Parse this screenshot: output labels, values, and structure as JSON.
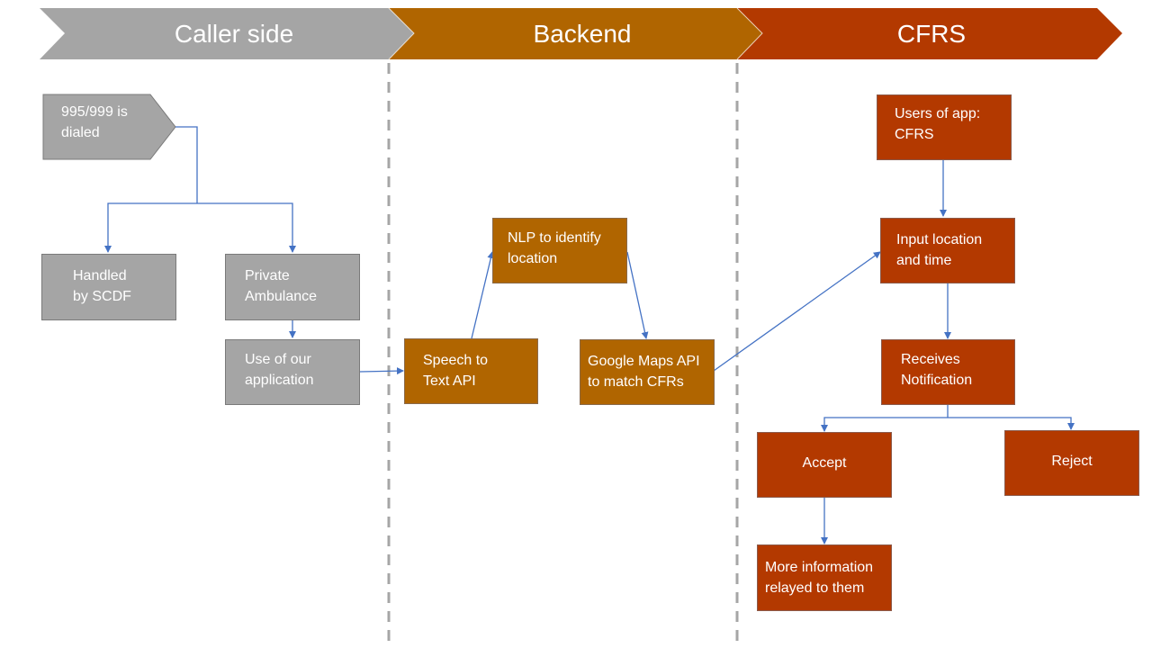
{
  "colors": {
    "caller": "#a5a5a5",
    "backend": "#b06500",
    "cfrs": "#b33900",
    "connector": "#4472c4",
    "divider": "#a6a6a6"
  },
  "bands": [
    {
      "label": "Caller side"
    },
    {
      "label": "Backend"
    },
    {
      "label": "CFRS"
    }
  ],
  "nodes": {
    "dialed": {
      "label": "995/999 is\ndialed"
    },
    "scdf": {
      "label": "Handled\nby SCDF"
    },
    "private_ambulance": {
      "label": "Private\nAmbulance"
    },
    "use_app": {
      "label": "Use of our\napplication"
    },
    "speech_to_text": {
      "label": "Speech to\nText API"
    },
    "nlp": {
      "label": "NLP to identify\nlocation"
    },
    "google_maps": {
      "label": "Google Maps API\nto match CFRs"
    },
    "users_app": {
      "label": "Users of app:\nCFRS"
    },
    "input_location": {
      "label": "Input location\nand time"
    },
    "receives_notification": {
      "label": "Receives\nNotification"
    },
    "accept": {
      "label": "Accept"
    },
    "reject": {
      "label": "Reject"
    },
    "more_info": {
      "label": "More information\nrelayed to them"
    }
  },
  "edges": [
    {
      "from": "dialed",
      "to": "scdf"
    },
    {
      "from": "dialed",
      "to": "private_ambulance"
    },
    {
      "from": "private_ambulance",
      "to": "use_app"
    },
    {
      "from": "use_app",
      "to": "speech_to_text"
    },
    {
      "from": "speech_to_text",
      "to": "nlp"
    },
    {
      "from": "nlp",
      "to": "google_maps"
    },
    {
      "from": "google_maps",
      "to": "input_location"
    },
    {
      "from": "users_app",
      "to": "input_location"
    },
    {
      "from": "input_location",
      "to": "receives_notification"
    },
    {
      "from": "receives_notification",
      "to": "accept"
    },
    {
      "from": "receives_notification",
      "to": "reject"
    },
    {
      "from": "accept",
      "to": "more_info"
    }
  ]
}
